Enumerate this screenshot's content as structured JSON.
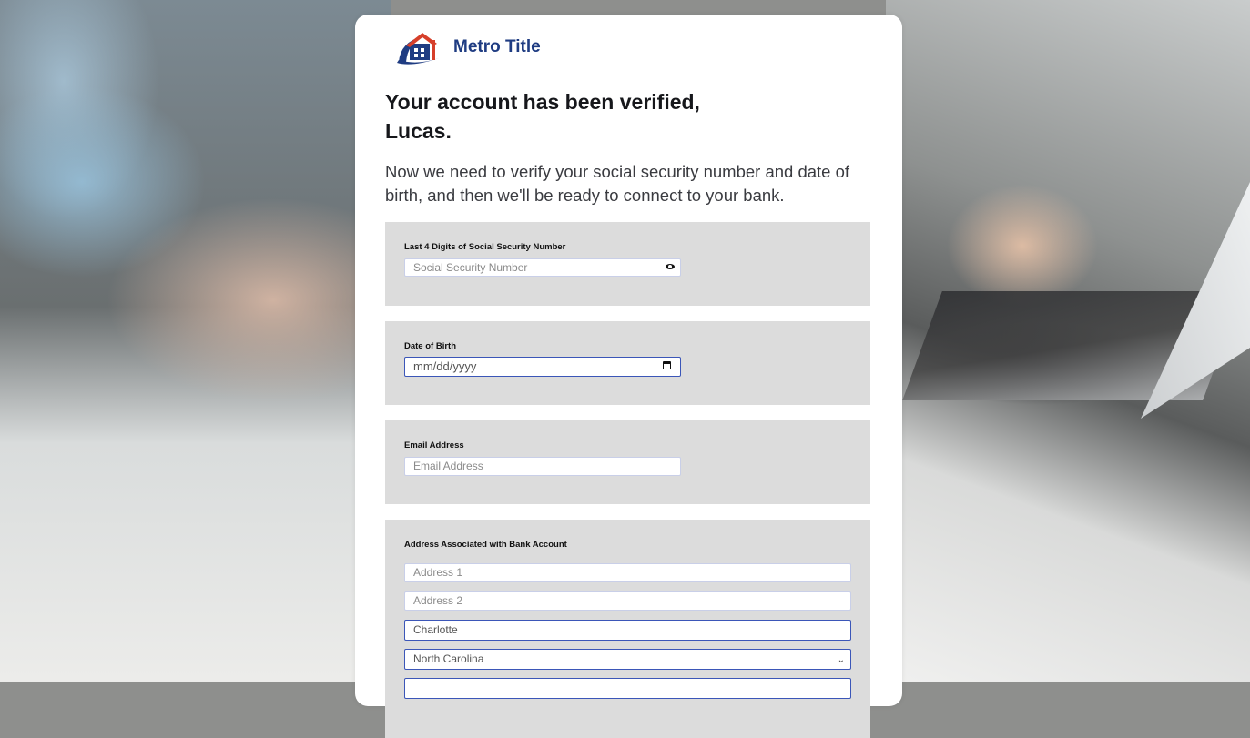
{
  "brand": {
    "name": "Metro Title",
    "primary_color": "#1f3c82",
    "accent_color": "#d63f2a",
    "icon": "house-logo-icon"
  },
  "heading": {
    "line1": "Your account has been verified,",
    "line2": "Lucas."
  },
  "intro": "Now we need to verify your social security number and date of birth, and then we'll be ready to connect to your bank.",
  "ssn": {
    "label": "Last 4 Digits of Social Security Number",
    "placeholder": "Social Security Number",
    "icon": "eye-icon"
  },
  "dob": {
    "label": "Date of Birth",
    "placeholder": "mm/dd/yyyy",
    "icon": "calendar-icon"
  },
  "email": {
    "label": "Email Address",
    "placeholder": "Email Address"
  },
  "address": {
    "label": "Address Associated with Bank Account",
    "address1_placeholder": "Address 1",
    "address2_placeholder": "Address 2",
    "city_value": "Charlotte",
    "state_value": "North Carolina",
    "state_icon": "chevron-down-icon"
  }
}
